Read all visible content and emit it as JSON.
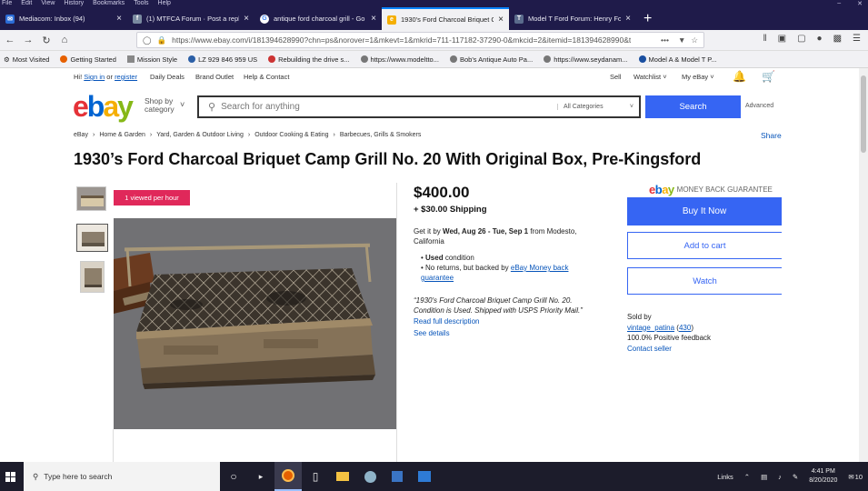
{
  "browser": {
    "menu": [
      "File",
      "Edit",
      "View",
      "History",
      "Bookmarks",
      "Tools",
      "Help"
    ],
    "tabs": [
      {
        "label": "Mediacom: Inbox (94)",
        "icon": "mail-icon",
        "color": "#2b6cd6",
        "active": false
      },
      {
        "label": "(1) MTFCA Forum · Post a reply",
        "icon": "forum-icon",
        "color": "#7a8aa0",
        "active": false
      },
      {
        "label": "antique ford charcoal grill - Go",
        "icon": "google-icon",
        "color": "#ffffff",
        "active": false
      },
      {
        "label": "1930's Ford Charcoal Briquet C",
        "icon": "ebay-icon",
        "color": "#f5af02",
        "active": true
      },
      {
        "label": "Model T Ford Forum: Henry Fo",
        "icon": "forum-icon",
        "color": "#5a6b8c",
        "active": false
      }
    ],
    "url": "https://www.ebay.com/i/181394628990?chn=ps&norover=1&mkevt=1&mkrid=711-117182-37290-0&mkcid=2&itemid=181394628990&t",
    "bookmarks": [
      "Most Visited",
      "Getting Started",
      "Mission Style",
      "LZ 929 846 959 US",
      "Rebuilding the drive s...",
      "https://www.modelttо...",
      "Bob's Antique Auto Pa...",
      "https://www.seydanam...",
      "Model A & Model T P..."
    ]
  },
  "ebay": {
    "topnav": {
      "greeting": "Hi!",
      "signin": "Sign in",
      "or": "or",
      "register": "register",
      "daily_deals": "Daily Deals",
      "brand_outlet": "Brand Outlet",
      "help": "Help & Contact",
      "sell": "Sell",
      "watchlist": "Watchlist",
      "myebay": "My eBay"
    },
    "shop_by": "Shop by category",
    "search_placeholder": "Search for anything",
    "category": "All Categories",
    "search_button": "Search",
    "advanced": "Advanced",
    "breadcrumbs": [
      "eBay",
      "Home & Garden",
      "Yard, Garden & Outdoor Living",
      "Outdoor Cooking & Eating",
      "Barbecues, Grills & Smokers"
    ],
    "share": "Share",
    "title": "1930’s Ford Charcoal Briquet Camp Grill No. 20 With Original Box, Pre-Kingsford",
    "badge": "1 viewed per hour",
    "price": "$400.00",
    "shipping": "+ $30.00 Shipping",
    "delivery": {
      "prefix": "Get it by",
      "dates": "Wed, Aug 26 - Tue, Sep 1",
      "from": "from Modesto, California"
    },
    "condition_label": "Used",
    "condition_suffix": "condition",
    "returns_text": "No returns, but backed by",
    "returns_link": "eBay Money back guarantee",
    "quote": "“1930's Ford Charcoal Briquet Camp Grill No. 20. Condition is Used. Shipped with USPS Priority Mail.”",
    "read_full": "Read full description",
    "see_details": "See details",
    "mbg_brand": "ebay",
    "mbg_text": "MONEY BACK GUARANTEE",
    "buy_now": "Buy It Now",
    "add_to_cart": "Add to cart",
    "watch": "Watch",
    "sold_by": "Sold by",
    "seller_name": "vintage_patina",
    "seller_score": "(430)",
    "feedback": "100.0% Positive feedback",
    "contact": "Contact seller"
  },
  "taskbar": {
    "search_placeholder": "Type here to search",
    "links": "Links",
    "time": "4:41 PM",
    "date": "8/20/2020",
    "notifications": "10"
  },
  "colors": {
    "accent": "#3665f3",
    "badge": "#e0285a",
    "link": "#0654ba",
    "titlebar": "#1f1b4a"
  }
}
